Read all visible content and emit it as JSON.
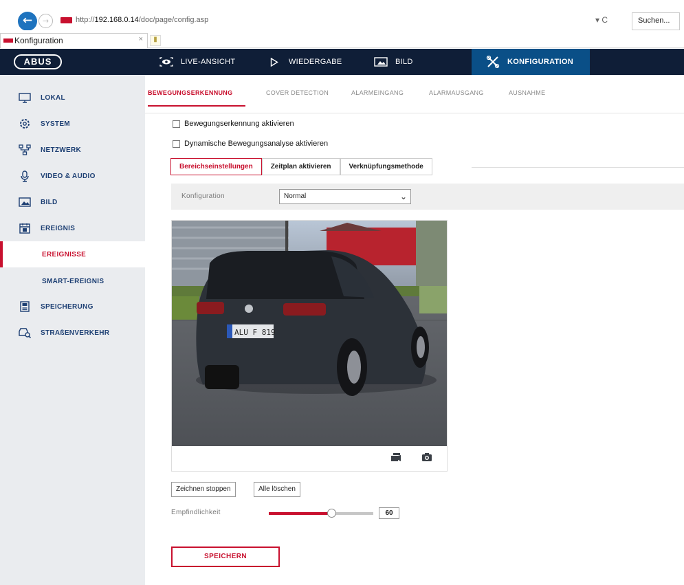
{
  "browser": {
    "url_prefix": "http://",
    "url_host": "192.168.0.14",
    "url_path": "/doc/page/config.asp",
    "refresh_symbol": "▾ C",
    "search_placeholder": "Suchen...",
    "tab_title": "Konfiguration",
    "tab_close": "×"
  },
  "header": {
    "logo_text": "ABUS",
    "nav": [
      {
        "label": "LIVE-ANSICHT",
        "icon": "eye-icon"
      },
      {
        "label": "WIEDERGABE",
        "icon": "play-icon"
      },
      {
        "label": "BILD",
        "icon": "image-icon"
      },
      {
        "label": "KONFIGURATION",
        "icon": "tools-icon",
        "active": true
      }
    ]
  },
  "sidebar": {
    "items": [
      {
        "label": "LOKAL",
        "icon": "monitor-icon"
      },
      {
        "label": "SYSTEM",
        "icon": "gear-icon"
      },
      {
        "label": "NETZWERK",
        "icon": "network-icon"
      },
      {
        "label": "VIDEO & AUDIO",
        "icon": "audio-icon"
      },
      {
        "label": "BILD",
        "icon": "image-icon"
      },
      {
        "label": "EREIGNIS",
        "icon": "calendar-icon"
      }
    ],
    "sub_items": [
      {
        "label": "EREIGNISSE",
        "selected": true
      },
      {
        "label": "SMART-EREIGNIS",
        "selected": false
      }
    ],
    "items_after": [
      {
        "label": "SPEICHERUNG",
        "icon": "storage-icon"
      },
      {
        "label": "STRAßENVERKEHR",
        "icon": "car-search-icon"
      }
    ]
  },
  "subtabs": [
    {
      "label": "BEWEGUNGSERKENNUNG",
      "active": true
    },
    {
      "label": "COVER DETECTION",
      "active": false
    },
    {
      "label": "ALARMEINGANG",
      "active": false
    },
    {
      "label": "ALARMAUSGANG",
      "active": false
    },
    {
      "label": "AUSNAHME",
      "active": false
    }
  ],
  "checkboxes": [
    {
      "label": "Bewegungserkennung aktivieren",
      "checked": false
    },
    {
      "label": "Dynamische Bewegungsanalyse aktivieren",
      "checked": false
    }
  ],
  "steps": [
    {
      "label": "Bereichseinstellungen",
      "active": true
    },
    {
      "label": "Zeitplan aktivieren",
      "active": false
    },
    {
      "label": "Verknüpfungsmethode",
      "active": false
    }
  ],
  "configuration": {
    "label": "Konfiguration",
    "selected_option": "Normal"
  },
  "video": {
    "license_plate": "ALU F 819",
    "tools": [
      "draw-area-icon",
      "camera-icon"
    ]
  },
  "buttons": {
    "stop_drawing": "Zeichnen stoppen",
    "clear_all": "Alle löschen",
    "save": "SPEICHERN"
  },
  "sensitivity": {
    "label": "Empfindlichkeit",
    "value": "60",
    "level": 0.6
  },
  "colors": {
    "accent": "#c8102e",
    "header_bg": "#0f1e37",
    "active_nav": "#0a4f87",
    "sidebar_text": "#1d3f73"
  }
}
